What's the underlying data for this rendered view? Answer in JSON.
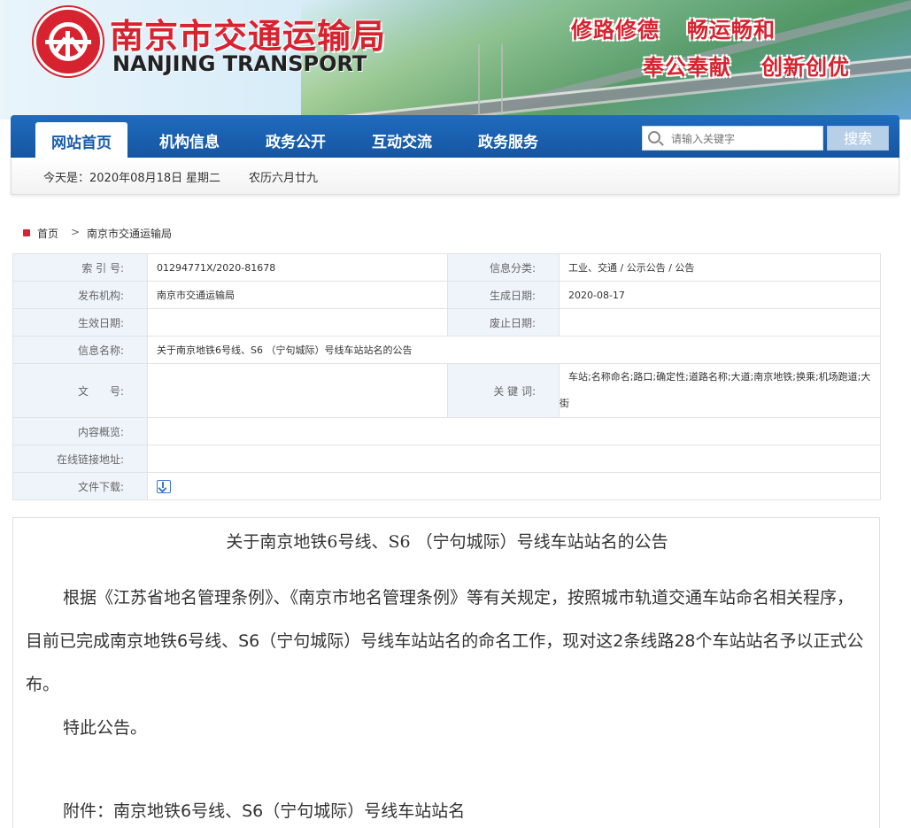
{
  "banner": {
    "logo_cn": "南京市交通运输局",
    "logo_en": "NANJING TRANSPORT",
    "slogans": [
      "修路修德",
      "畅运畅和",
      "奉公奉献",
      "创新创优"
    ]
  },
  "nav": {
    "items": [
      "网站首页",
      "机构信息",
      "政务公开",
      "互动交流",
      "政务服务"
    ],
    "active_index": 0,
    "search_placeholder": "请输入关键字",
    "search_button": "搜索"
  },
  "datebar": {
    "today": "今天是：2020年08月18日",
    "weekday": "星期二",
    "lunar": "农历六月廿九"
  },
  "breadcrumb": {
    "home": "首页",
    "separator": ">",
    "current": "南京市交通运输局"
  },
  "meta": {
    "index_label": "索 引 号:",
    "index_value": "01294771X/2020-81678",
    "category_label": "信息分类:",
    "category_value": "工业、交通 / 公示公告 / 公告",
    "publisher_label": "发布机构:",
    "publisher_value": "南京市交通运输局",
    "created_label": "生成日期:",
    "created_value": "2020-08-17",
    "effective_label": "生效日期:",
    "effective_value": "",
    "expire_label": "废止日期:",
    "expire_value": "",
    "name_label": "信息名称:",
    "name_value": "关于南京地铁6号线、S6 （宁句城际）号线车站站名的公告",
    "doc_no_label": "文　　号:",
    "doc_no_value": "",
    "keywords_label": "关 键 词:",
    "keywords_value": "车站;名称命名;路口;确定性;道路名称;大道;南京地铁;换乘;机场跑道;大街",
    "summary_label": "内容概览:",
    "summary_value": "",
    "link_label": "在线链接地址:",
    "link_value": "",
    "download_label": "文件下载:",
    "download_icon": "download-icon"
  },
  "article": {
    "title": "关于南京地铁6号线、S6 （宁句城际）号线车站站名的公告",
    "paragraph1": "根据《江苏省地名管理条例》、《南京市地名管理条例》等有关规定，按照城市轨道交通车站命名相关程序，目前已完成南京地铁6号线、S6（宁句城际）号线车站站名的命名工作，现对这2条线路28个车站站名予以正式公布。",
    "paragraph2": "特此公告。",
    "attachment": "附件：南京地铁6号线、S6（宁句城际）号线车站站名"
  },
  "colors": {
    "brand_red": "#d7232f",
    "nav_blue": "#1a5dab",
    "label_bg": "#eef4fa"
  }
}
